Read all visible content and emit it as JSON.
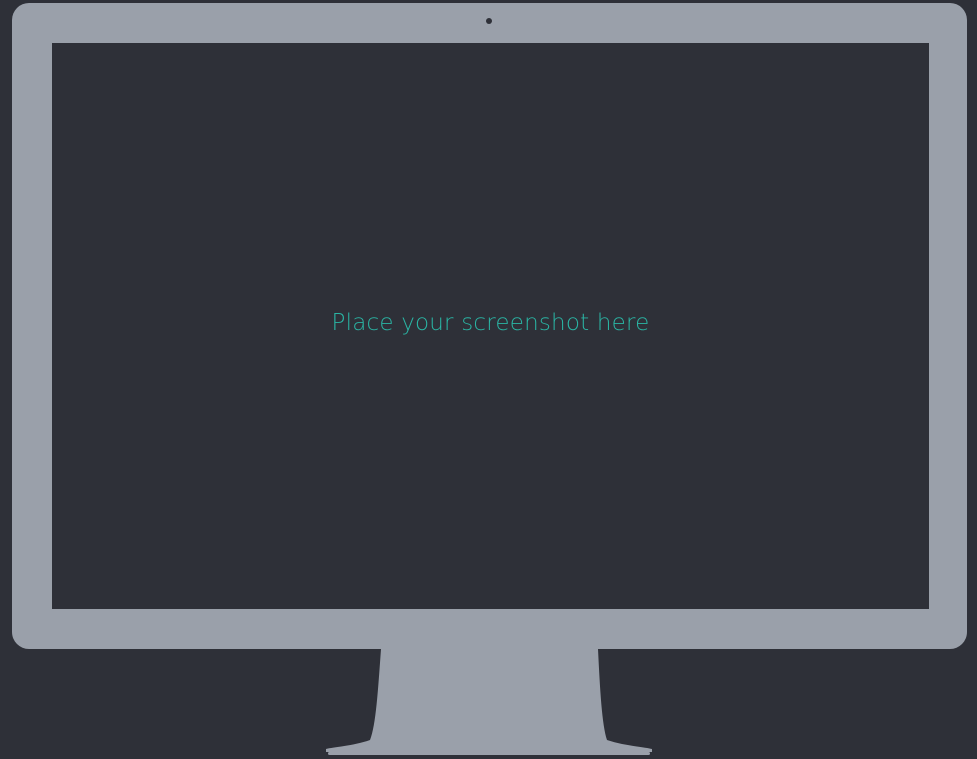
{
  "screen": {
    "placeholder": "Place your screenshot here"
  },
  "colors": {
    "background": "#2e3038",
    "bezel": "#9aa0aa",
    "screen": "#2e3038",
    "accent_text": "#2ab5a4"
  },
  "icons": {
    "camera": "camera-dot-icon"
  }
}
